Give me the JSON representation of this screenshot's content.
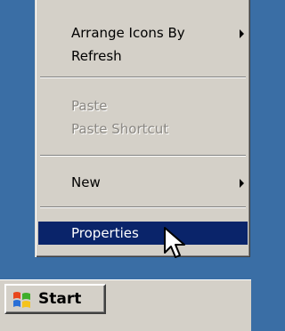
{
  "context_menu": {
    "items": [
      {
        "label": "Arrange Icons By",
        "enabled": true,
        "submenu": true
      },
      {
        "label": "Refresh",
        "enabled": true,
        "submenu": false
      },
      {
        "label": "Paste",
        "enabled": false,
        "submenu": false
      },
      {
        "label": "Paste Shortcut",
        "enabled": false,
        "submenu": false
      },
      {
        "label": "New",
        "enabled": true,
        "submenu": true
      },
      {
        "label": "Properties",
        "enabled": true,
        "submenu": false,
        "selected": true
      }
    ]
  },
  "taskbar": {
    "start_label": "Start"
  },
  "colors": {
    "desktop": "#3a6ea5",
    "menu_face": "#d4d0c8",
    "selection": "#0a246a",
    "disabled_text": "#8a8782"
  },
  "icons": {
    "start_logo": "windows-flag-icon",
    "submenu_arrow": "chevron-right-icon",
    "pointer": "mouse-cursor-icon"
  }
}
